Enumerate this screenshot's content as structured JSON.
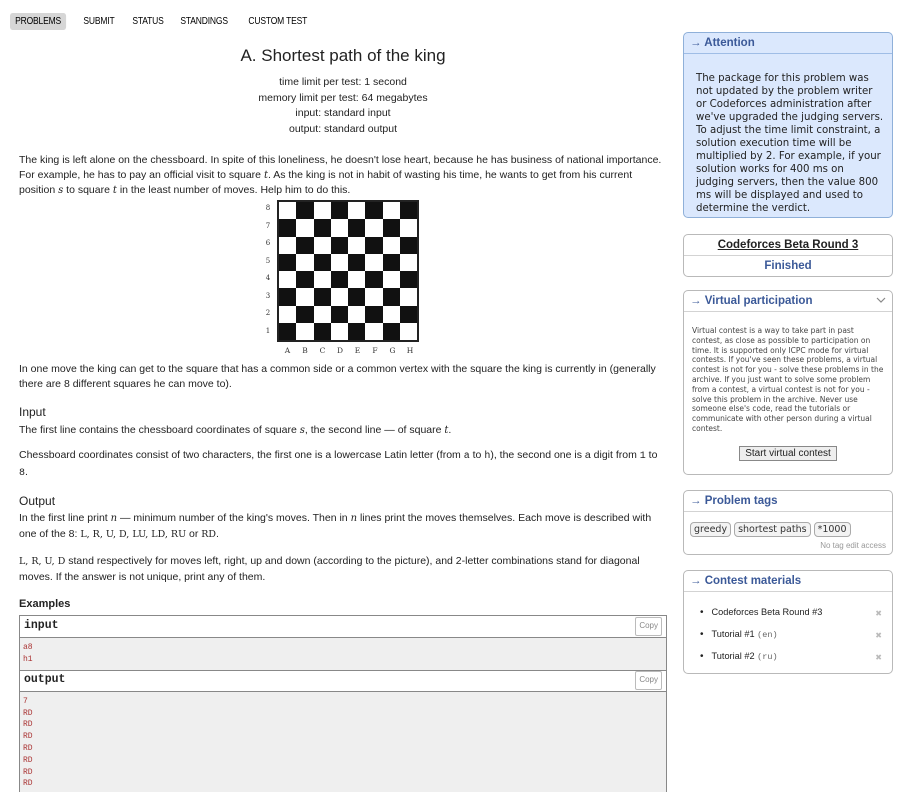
{
  "nav": [
    "PROBLEMS",
    "SUBMIT",
    "STATUS",
    "STANDINGS",
    "CUSTOM TEST"
  ],
  "problem": {
    "title": "A. Shortest path of the king",
    "limits": [
      "time limit per test: 1 second",
      "memory limit per test: 64 megabytes",
      "input: standard input",
      "output: standard output"
    ],
    "statement_1a": "The king is left alone on the chessboard. In spite of this loneliness, he doesn't lose heart, because he has business of national importance. For example, he has to pay an official visit to square ",
    "statement_1b": ". As the king is not in habit of wasting his time, he wants to get from his current position ",
    "statement_1c": " to square ",
    "statement_1d": " in the least number of moves. Help him to do this.",
    "var_t": "t",
    "var_s": "s",
    "var_n": "n",
    "board_ranks": [
      "8",
      "7",
      "6",
      "5",
      "4",
      "3",
      "2",
      "1"
    ],
    "board_files": [
      "A",
      "B",
      "C",
      "D",
      "E",
      "F",
      "G",
      "H"
    ],
    "statement_2": "In one move the king can get to the square that has a common side or a common vertex with the square the king is currently in (generally there are 8 different squares he can move to).",
    "input_title": "Input",
    "input_1a": "The first line contains the chessboard coordinates of square ",
    "input_1b": ", the second line — of square ",
    "input_2a": "Chessboard coordinates consist of two characters, the first one is a lowercase Latin letter (from ",
    "input_2_a": "a",
    "input_2b": " to ",
    "input_2_h": "h",
    "input_2c": "), the second one is a digit from ",
    "input_2_1": "1",
    "input_2d": " to ",
    "input_2_8": "8",
    "input_2e": ".",
    "output_title": "Output",
    "output_1a": "In the first line print ",
    "output_1b": " — minimum number of the king's moves. Then in ",
    "output_1c": " lines print the moves themselves. Each move is described with one of the 8: ",
    "output_moves": "L, R, U, D, LU, LD, RU",
    "output_or": " or ",
    "output_rd": "RD",
    "output_1d": ".",
    "output_2a": "L, R, U, D",
    "output_2b": " stand respectively for moves left, right, up and down (according to the picture), and 2-letter combinations stand for diagonal moves. If the answer is not unique, print any of them.",
    "examples_title": "Examples",
    "input_label": "input",
    "output_label": "output",
    "copy_label": "Copy",
    "sample_input": [
      "a8",
      "h1"
    ],
    "sample_output": [
      "7",
      "RD",
      "RD",
      "RD",
      "RD",
      "RD",
      "RD",
      "RD"
    ]
  },
  "sidebar": {
    "attention_title": "→ Attention",
    "attention_text": "The package for this problem was not updated by the problem writer or Codeforces administration after we've upgraded the judging servers. To adjust the time limit constraint, a solution execution time will be multiplied by 2. For example, if your solution works for 400 ms on judging servers, then the value 800 ms will be displayed and used to determine the verdict.",
    "round_name": "Codeforces Beta Round 3",
    "round_status": "Finished",
    "vp_title": "→ Virtual participation",
    "vp_text": "Virtual contest is a way to take part in past contest, as close as possible to participation on time. It is supported only ICPC mode for virtual contests. If you've seen these problems, a virtual contest is not for you - solve these problems in the archive. If you just want to solve some problem from a contest, a virtual contest is not for you - solve this problem in the archive. Never use someone else's code, read the tutorials or communicate with other person during a virtual contest.",
    "vp_button": "Start virtual contest",
    "tags_title": "→ Problem tags",
    "tags": [
      "greedy",
      "shortest paths",
      "*1000"
    ],
    "tags_note": "No tag edit access",
    "materials_title": "→ Contest materials",
    "materials": [
      {
        "label": "Codeforces Beta Round #3",
        "lang": ""
      },
      {
        "label": "Tutorial #1 ",
        "lang": "(en)"
      },
      {
        "label": "Tutorial #2 ",
        "lang": "(ru)"
      }
    ]
  }
}
